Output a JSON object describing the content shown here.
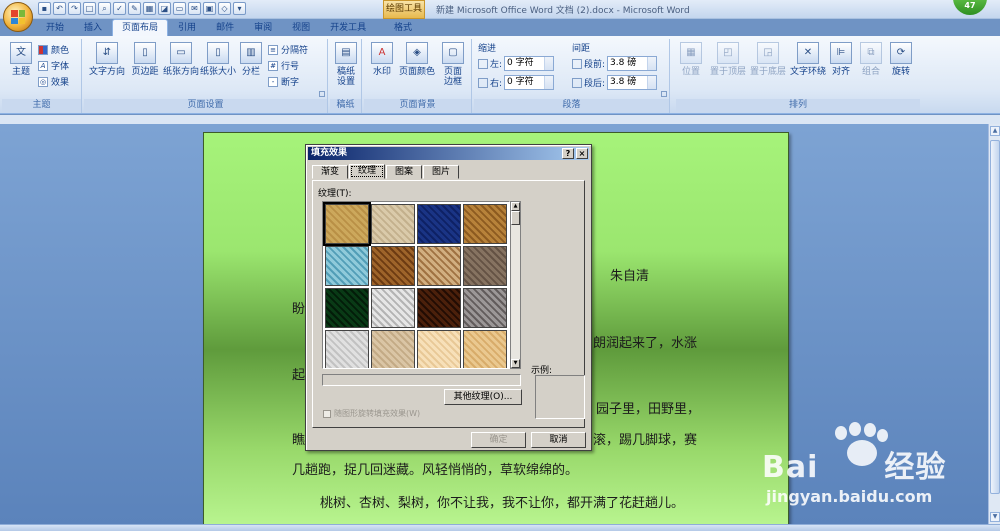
{
  "window": {
    "title": "新建 Microsoft Office Word 文档 (2).docx - Microsoft Word",
    "contextual_tool": "绘图工具",
    "user_badge": "47"
  },
  "tabs": [
    "开始",
    "插入",
    "页面布局",
    "引用",
    "邮件",
    "审阅",
    "视图",
    "开发工具"
  ],
  "format_tab": "格式",
  "ribbon": {
    "theme": {
      "label": "主题",
      "main": "主题",
      "colors": "颜色",
      "fonts": "字体",
      "effects": "效果"
    },
    "page_setup": {
      "label": "页面设置",
      "text_direction": "文字方向",
      "margins": "页边距",
      "orientation": "纸张方向",
      "size": "纸张大小",
      "columns": "分栏",
      "breaks": "分隔符",
      "line_numbers": "行号",
      "hyphenation": "断字"
    },
    "draft": {
      "label": "稿纸",
      "button": "稿纸\n设置"
    },
    "background": {
      "label": "页面背景",
      "watermark": "水印",
      "page_color": "页面颜色",
      "borders": "页面\n边框"
    },
    "paragraph": {
      "label": "段落",
      "indent": "缩进",
      "spacing": "间距",
      "left": "左:",
      "right": "右:",
      "before": "段前:",
      "after": "段后:",
      "left_value": "0 字符",
      "right_value": "0 字符",
      "before_value": "3.8 磅",
      "after_value": "3.8 磅"
    },
    "arrange": {
      "label": "排列",
      "position": "位置",
      "bring_front": "置于顶层",
      "send_back": "置于底层",
      "wrap": "文字环绕",
      "align": "对齐",
      "group": "组合",
      "rotate": "旋转"
    }
  },
  "document": {
    "author": "朱自清",
    "lines": [
      "盼",
      "朗润起来了，水涨",
      "起",
      "园子里，田野里，",
      "瞧",
      "滚，踢几脚球，赛",
      "几趟跑，捉几回迷藏。风轻悄悄的，草软绵绵的。",
      "桃树、杏树、梨树，你不让我，我不让你，都开满了花赶趟儿。"
    ]
  },
  "dialog": {
    "title": "填充效果",
    "help": "?",
    "close": "×",
    "tabs": [
      "渐变",
      "纹理",
      "图案",
      "图片"
    ],
    "active_tab": "纹理",
    "texture_label": "纹理(T):",
    "other_texture_button": "其他纹理(O)...",
    "sample_label": "示例:",
    "rotate_checkbox": "随图形旋转填充效果(W)",
    "ok": "确定",
    "cancel": "取消",
    "textures": [
      {
        "name": "papyrus",
        "c1": "#e4cf99",
        "c2": "#cfb275"
      },
      {
        "name": "canvas",
        "c1": "#ece3d0",
        "c2": "#d3c6ad"
      },
      {
        "name": "denim",
        "c1": "#5273b8",
        "c2": "#2d4a8c"
      },
      {
        "name": "woven-mat",
        "c1": "#d8b67a",
        "c2": "#a67f43"
      },
      {
        "name": "water-droplets",
        "c1": "#bfe3ec",
        "c2": "#6eb2c6"
      },
      {
        "name": "paper-bag",
        "c1": "#c9a068",
        "c2": "#8a5e2c"
      },
      {
        "name": "fish-fossil",
        "c1": "#e7d3b5",
        "c2": "#b08a5d"
      },
      {
        "name": "sand",
        "c1": "#b9ab9d",
        "c2": "#8a7b6e"
      },
      {
        "name": "green-marble",
        "c1": "#2f7a4a",
        "c2": "#0f3b20"
      },
      {
        "name": "white-marble",
        "c1": "#f2f2f2",
        "c2": "#bdbdbd"
      },
      {
        "name": "brown-marble",
        "c1": "#8a5a35",
        "c2": "#3f230f"
      },
      {
        "name": "granite",
        "c1": "#c7c4c4",
        "c2": "#7d7878"
      },
      {
        "name": "newsprint",
        "c1": "#efefef",
        "c2": "#cfcfcf"
      },
      {
        "name": "recycled-paper",
        "c1": "#ece0cd",
        "c2": "#d3c2a6"
      },
      {
        "name": "parchment",
        "c1": "#fbefd9",
        "c2": "#ecd6b1"
      },
      {
        "name": "stationery",
        "c1": "#f4e2bf",
        "c2": "#e2c28e"
      }
    ]
  },
  "watermark": {
    "brand": "Bai",
    "brand2": "经验",
    "url": "jingyan.baidu.com"
  }
}
